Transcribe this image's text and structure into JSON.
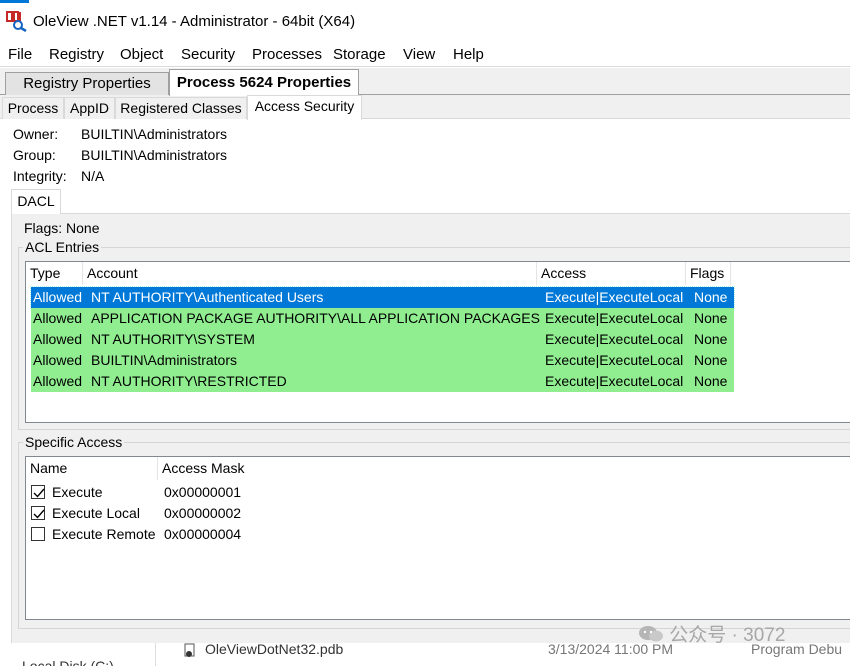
{
  "window": {
    "title": "OleView .NET v1.14 - Administrator - 64bit (X64)",
    "app_icon": "oleview-app-icon"
  },
  "menu": [
    "File",
    "Registry",
    "Object",
    "Security",
    "Processes",
    "Storage",
    "View",
    "Help"
  ],
  "document_tabs": [
    {
      "label": "Registry Properties",
      "active": false
    },
    {
      "label": "Process 5624 Properties",
      "active": true
    }
  ],
  "inner_tabs": [
    {
      "label": "Process",
      "active": false
    },
    {
      "label": "AppID",
      "active": false
    },
    {
      "label": "Registered Classes",
      "active": false
    },
    {
      "label": "Access Security",
      "active": true
    }
  ],
  "security": {
    "owner_label": "Owner:",
    "owner": "BUILTIN\\Administrators",
    "group_label": "Group:",
    "group": "BUILTIN\\Administrators",
    "integrity_label": "Integrity:",
    "integrity": "N/A"
  },
  "dacl_tab": "DACL",
  "flags_text": "Flags: None",
  "acl": {
    "legend": "ACL Entries",
    "columns": [
      "Type",
      "Account",
      "Access",
      "Flags"
    ],
    "rows": [
      {
        "type": "Allowed",
        "account": "NT AUTHORITY\\Authenticated Users",
        "access": "Execute|ExecuteLocal",
        "flags": "None",
        "selected": true
      },
      {
        "type": "Allowed",
        "account": "APPLICATION PACKAGE AUTHORITY\\ALL APPLICATION PACKAGES",
        "access": "Execute|ExecuteLocal",
        "flags": "None"
      },
      {
        "type": "Allowed",
        "account": "NT AUTHORITY\\SYSTEM",
        "access": "Execute|ExecuteLocal",
        "flags": "None"
      },
      {
        "type": "Allowed",
        "account": "BUILTIN\\Administrators",
        "access": "Execute|ExecuteLocal",
        "flags": "None"
      },
      {
        "type": "Allowed",
        "account": "NT AUTHORITY\\RESTRICTED",
        "access": "Execute|ExecuteLocal",
        "flags": "None"
      }
    ],
    "row_color": "#90ee90",
    "selected_color": "#0078d7"
  },
  "specific": {
    "legend": "Specific Access",
    "columns": [
      "Name",
      "Access Mask"
    ],
    "rows": [
      {
        "name": "Execute",
        "mask": "0x00000001",
        "checked": true
      },
      {
        "name": "Execute Local",
        "mask": "0x00000002",
        "checked": true
      },
      {
        "name": "Execute Remote",
        "mask": "0x00000004",
        "checked": false
      }
    ]
  },
  "background": {
    "left_text": "Local Disk (C:)",
    "file_name": "OleViewDotNet32.pdb",
    "file_date": "3/13/2024 11:00 PM",
    "file_type": "Program Debu"
  },
  "watermark": "公众号 · 3072"
}
